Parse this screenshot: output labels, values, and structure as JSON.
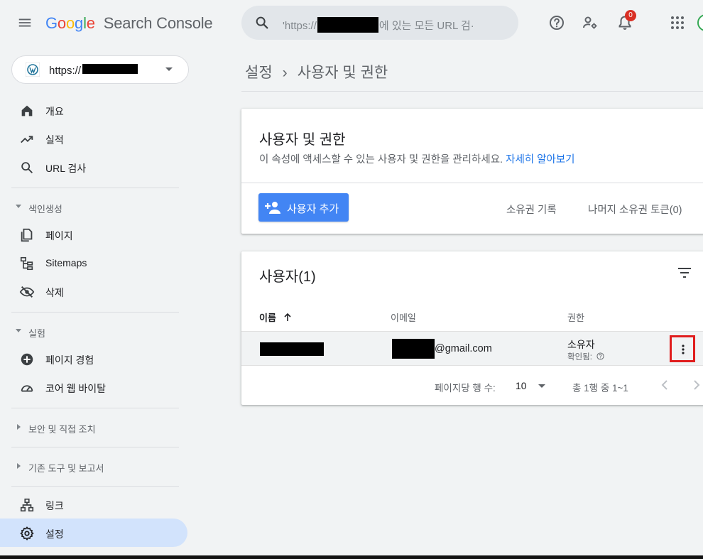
{
  "header": {
    "logo_google": [
      "G",
      "o",
      "o",
      "g",
      "l",
      "e"
    ],
    "logo_product": "Search Console",
    "search_placeholder_prefix": "'https://",
    "search_placeholder_suffix": "에 있는 모든 URL 검·",
    "notification_count": "0",
    "icons": [
      "menu-icon",
      "search-icon",
      "help-icon",
      "manage-users-icon",
      "bell-icon",
      "apps-icon"
    ]
  },
  "sidebar": {
    "property_label": "https://",
    "items": [
      {
        "label": "개요",
        "icon": "home-icon"
      },
      {
        "label": "실적",
        "icon": "trending-up-icon"
      },
      {
        "label": "URL 검사",
        "icon": "search-icon"
      }
    ],
    "sections": [
      {
        "label": "색인생성",
        "expanded": true,
        "items": [
          {
            "label": "페이지",
            "icon": "pages-icon"
          },
          {
            "label": "Sitemaps",
            "icon": "sitemap-icon"
          },
          {
            "label": "삭제",
            "icon": "eye-off-icon"
          }
        ]
      },
      {
        "label": "실험",
        "expanded": true,
        "items": [
          {
            "label": "페이지 경험",
            "icon": "plus-circle-icon"
          },
          {
            "label": "코어 웹 바이탈",
            "icon": "gauge-icon"
          }
        ]
      },
      {
        "label": "보안 및 직접 조치",
        "expanded": false
      },
      {
        "label": "기존 도구 및 보고서",
        "expanded": false
      }
    ],
    "bottom_items": [
      {
        "label": "링크",
        "icon": "links-icon"
      },
      {
        "label": "설정",
        "icon": "gear-icon",
        "active": true
      }
    ]
  },
  "breadcrumb": {
    "parent": "설정",
    "separator": "›",
    "current": "사용자 및 권한"
  },
  "permissions_card": {
    "title": "사용자 및 권한",
    "description": "이 속성에 액세스할 수 있는 사용자 및 권한을 관리하세요.",
    "learn_more": "자세히 알아보기",
    "add_user_label": "사용자 추가",
    "ownership_history_label": "소유권 기록",
    "unverify_label": "나머지 소유권 토큰(0)"
  },
  "users_card": {
    "title": "사용자(1)",
    "columns": {
      "name": "이름",
      "email": "이메일",
      "permission": "권한"
    },
    "rows": [
      {
        "email_domain": "@gmail.com",
        "permission": "소유자",
        "permission_sub": "확인됨:"
      }
    ],
    "pagination": {
      "rows_per_page_label": "페이지당 행 수:",
      "rows_per_page": "10",
      "range": "총 1행 중 1~1"
    }
  },
  "colors": {
    "accent": "#4285f4",
    "active_nav": "#d2e3fc",
    "highlight_box": "#e01d1d",
    "link": "#1a73e8"
  }
}
